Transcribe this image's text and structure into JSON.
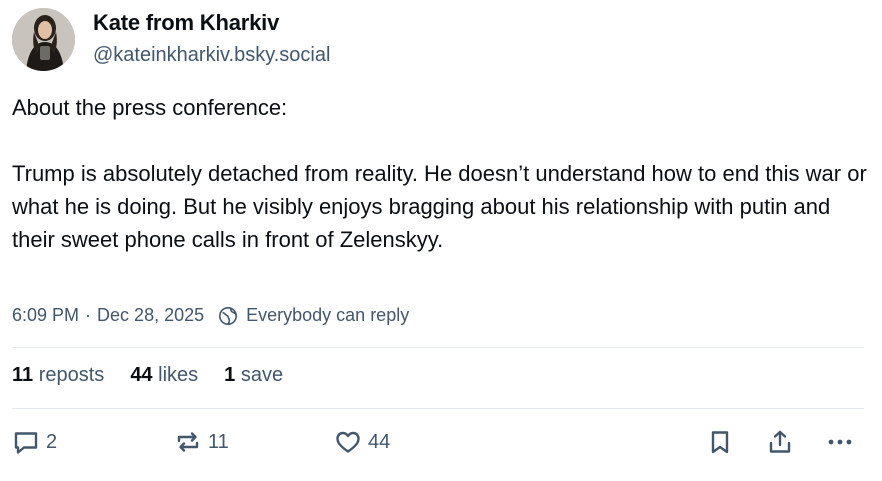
{
  "author": {
    "name": "Kate from Kharkiv",
    "handle": "@kateinkharkiv.bsky.social"
  },
  "post": {
    "paragraphs": [
      "About the press conference:",
      "Trump is absolutely detached from reality. He doesn’t understand how to end this war or what he is doing. But he visibly enjoys bragging about his relationship with putin and their sweet phone calls in front of Zelenskyy."
    ]
  },
  "meta": {
    "time": "6:09 PM",
    "separator": "·",
    "date": "Dec 28, 2025",
    "reply_policy": "Everybody can reply",
    "reply_policy_icon": "globe-icon"
  },
  "stats": {
    "reposts_count": "11",
    "reposts_label": "reposts",
    "likes_count": "44",
    "likes_label": "likes",
    "saves_count": "1",
    "saves_label": "save"
  },
  "actions": {
    "reply_count": "2",
    "reply_icon": "reply-icon",
    "repost_count": "11",
    "repost_icon": "repost-icon",
    "like_count": "44",
    "like_icon": "heart-icon",
    "bookmark_icon": "bookmark-icon",
    "share_icon": "share-icon",
    "more_icon": "more-icon"
  },
  "colors": {
    "text": "#0b0f14",
    "secondary": "#42576c",
    "divider": "#e4e8ec"
  }
}
